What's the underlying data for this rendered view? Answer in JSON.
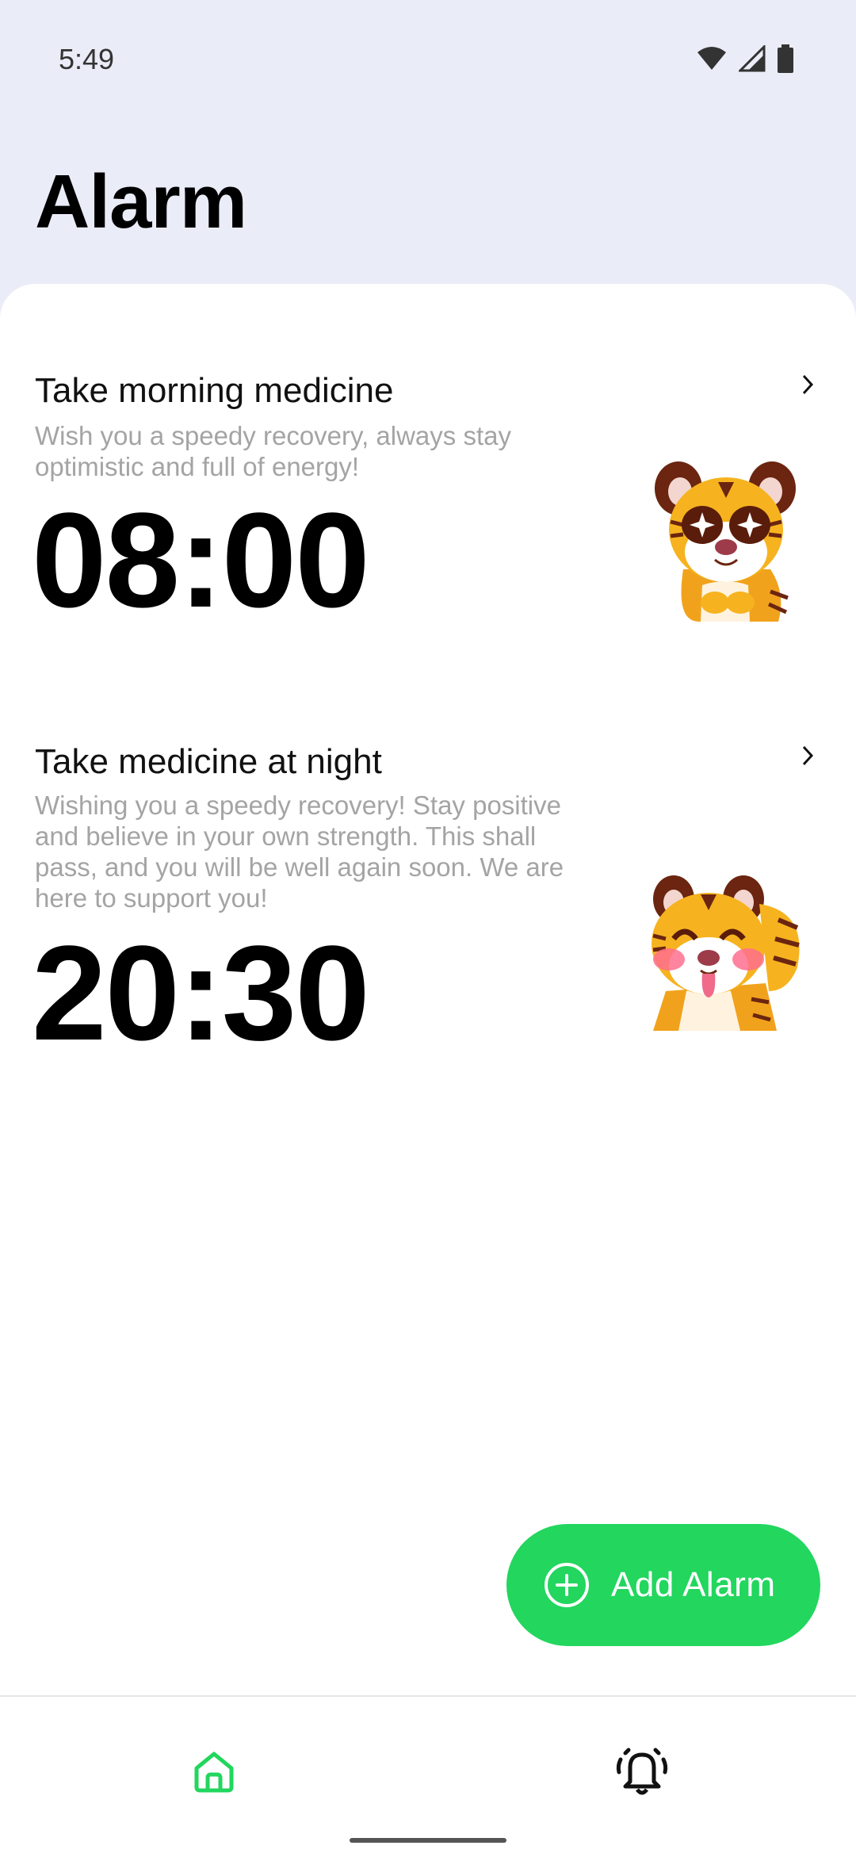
{
  "status_bar": {
    "time": "5:49"
  },
  "header": {
    "title": "Alarm"
  },
  "alarms": [
    {
      "title": "Take morning medicine",
      "description": "Wish you a speedy recovery, always stay optimistic and full of energy!",
      "time": "08:00",
      "sticker": "tiger-starry-eyes-sticker"
    },
    {
      "title": "Take medicine at night",
      "description": "Wishing you a speedy recovery! Stay positive and believe in your own strength. This shall pass, and you will be well again soon. We are here to support you!",
      "time": "20:30",
      "sticker": "tiger-tongue-out-sticker"
    }
  ],
  "fab": {
    "label": "Add Alarm",
    "icon": "add-circle-icon"
  },
  "bottom_nav": [
    {
      "icon": "home-icon",
      "active": true
    },
    {
      "icon": "bell-icon",
      "active": false
    }
  ],
  "colors": {
    "accent": "#22d65e",
    "header_bg": "#eaecf8",
    "muted_text": "#a4a4a4"
  }
}
